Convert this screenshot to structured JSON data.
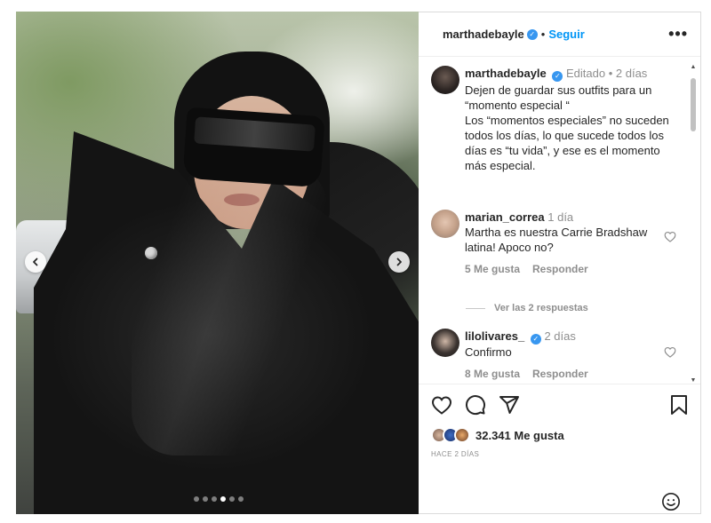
{
  "post": {
    "author": "marthadebayle",
    "follow_label": "Seguir",
    "header_separator": "•",
    "more_glyph": "•••",
    "caption": {
      "username": "marthadebayle",
      "meta": "Editado • 2 días",
      "text": "Dejen de guardar sus outfits para un “momento especial “\nLos “momentos especiales” no suceden todos los días, lo que sucede todos los días es “tu vida”, y ese es el momento más especial."
    },
    "comments": [
      {
        "username": "marian_correa",
        "time": "1 día",
        "text": "Martha es nuestra Carrie Bradshaw latina! Apoco no?",
        "likes": "5 Me gusta",
        "reply_label": "Responder",
        "view_replies": "Ver las 2 respuestas"
      },
      {
        "username": "lilolivares_",
        "time": "2 días",
        "text": "Confirmo",
        "likes": "8 Me gusta",
        "reply_label": "Responder"
      }
    ],
    "likes_count": "32.341 Me gusta",
    "posted": "HACE 2 DÍAS",
    "carousel": {
      "total": 6,
      "active_index": 3
    },
    "icons": [
      "heart-icon",
      "comment-icon",
      "share-icon",
      "bookmark-icon",
      "emoji-icon",
      "chevron-left-icon",
      "chevron-right-icon",
      "verified-badge-icon",
      "more-options-icon"
    ]
  },
  "colors": {
    "link_blue": "#0095f6",
    "verified_blue": "#3897f0",
    "text": "#262626",
    "muted": "#8e8e8e",
    "border": "#dbdbdb"
  }
}
